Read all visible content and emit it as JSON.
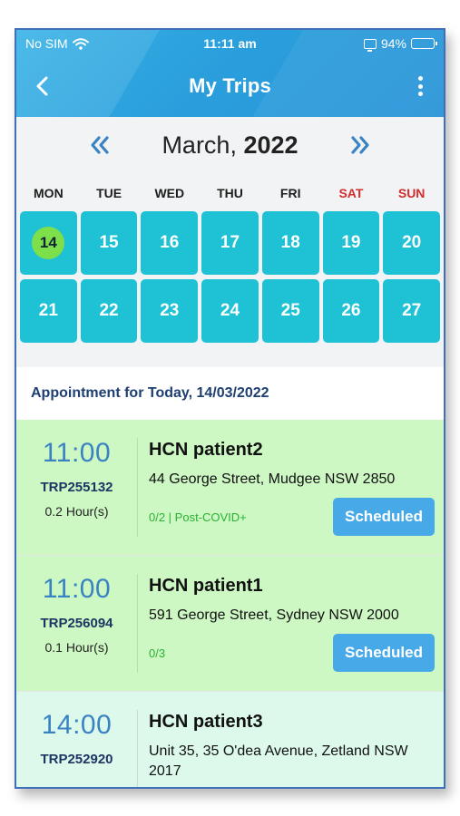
{
  "status_bar": {
    "carrier": "No SIM",
    "time": "11:11 am",
    "battery": "94%"
  },
  "header": {
    "title": "My Trips"
  },
  "calendar": {
    "month": "March,",
    "year": "2022",
    "weekdays": [
      "MON",
      "TUE",
      "WED",
      "THU",
      "FRI",
      "SAT",
      "SUN"
    ],
    "week1": [
      "14",
      "15",
      "16",
      "17",
      "18",
      "19",
      "20"
    ],
    "week2": [
      "21",
      "22",
      "23",
      "24",
      "25",
      "26",
      "27"
    ],
    "selected_day": "14"
  },
  "appointments": {
    "title": "Appointment for Today, 14/03/2022",
    "trips": [
      {
        "time": "11:00",
        "id": "TRP255132",
        "duration": "0.2 Hour(s)",
        "patient": "HCN patient2",
        "address": "44 George Street, Mudgee NSW 2850",
        "meta": "0/2 | Post-COVID+",
        "status": "Scheduled"
      },
      {
        "time": "11:00",
        "id": "TRP256094",
        "duration": "0.1 Hour(s)",
        "patient": "HCN patient1",
        "address": "591 George Street, Sydney NSW 2000",
        "meta": "0/3",
        "status": "Scheduled"
      },
      {
        "time": "14:00",
        "id": "TRP252920",
        "patient": "HCN patient3",
        "address": "Unit 35, 35 O'dea Avenue, Zetland NSW 2017"
      }
    ]
  },
  "colors": {
    "header": "#2a9fdc",
    "day_tile": "#1fc2d4",
    "selected_day": "#7de04a",
    "weekend": "#d22c2c",
    "card_green": "#cdf7c3",
    "card_mint": "#ddf9ec",
    "button": "#48a9e8"
  }
}
